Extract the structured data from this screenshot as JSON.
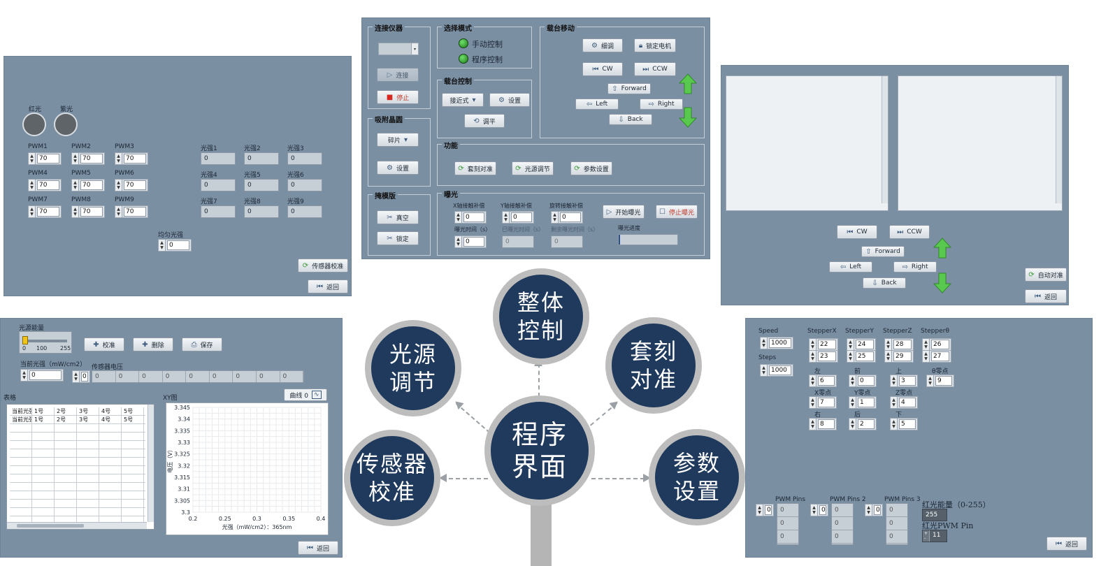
{
  "center": {
    "title": "程序界面"
  },
  "spokes": {
    "overall": "整体控制",
    "light_source": "光源调节",
    "alignment": "套刻对准",
    "sensor": "传感器校准",
    "params": "参数设置"
  },
  "sensor_panel": {
    "lamps": [
      "红光",
      "紫光"
    ],
    "pwm": [
      {
        "label": "PWM1",
        "value": "70"
      },
      {
        "label": "PWM2",
        "value": "70"
      },
      {
        "label": "PWM3",
        "value": "70"
      },
      {
        "label": "PWM4",
        "value": "70"
      },
      {
        "label": "PWM5",
        "value": "70"
      },
      {
        "label": "PWM6",
        "value": "70"
      },
      {
        "label": "PWM7",
        "value": "70"
      },
      {
        "label": "PWM8",
        "value": "70"
      },
      {
        "label": "PWM9",
        "value": "70"
      }
    ],
    "light": [
      {
        "label": "光强1",
        "value": "0"
      },
      {
        "label": "光强2",
        "value": "0"
      },
      {
        "label": "光强3",
        "value": "0"
      },
      {
        "label": "光强4",
        "value": "0"
      },
      {
        "label": "光强5",
        "value": "0"
      },
      {
        "label": "光强6",
        "value": "0"
      },
      {
        "label": "光强7",
        "value": "0"
      },
      {
        "label": "光强8",
        "value": "0"
      },
      {
        "label": "光强9",
        "value": "0"
      }
    ],
    "uniform_label": "均匀光强",
    "uniform_value": "0",
    "calibrate_button": "传感器校准",
    "back_button": "返回"
  },
  "main_panel": {
    "connect_group": "连接仪器",
    "connect_button": "连接",
    "stop_button": "停止",
    "mode_group": "选择模式",
    "mode_manual": "手动控制",
    "mode_program": "程序控制",
    "stage_move_group": "载台移动",
    "fine_button": "细调",
    "lock_motor_button": "锁定电机",
    "cw": "CW",
    "ccw": "CCW",
    "forward": "Forward",
    "left": "Left",
    "right": "Right",
    "back": "Back",
    "stage_ctrl_group": "载台控制",
    "stage_mode": "接近式",
    "settings_button": "设置",
    "level_button": "调平",
    "chuck_group": "吸附晶圆",
    "chuck_mode": "碎片",
    "chuck_settings": "设置",
    "func_group": "功能",
    "func_align": "套刻对准",
    "func_light": "光源调节",
    "func_params": "参数设置",
    "mask_group": "掩模版",
    "vacuum_button": "真空",
    "lock_button": "锁定",
    "exposure_group": "曝光",
    "x_comp_label": "X轴接触补偿",
    "x_comp": "0",
    "y_comp_label": "Y轴接触补偿",
    "y_comp": "0",
    "rot_comp_label": "旋转接触补偿",
    "rot_comp": "0",
    "exp_time_label": "曝光时间（s）",
    "exp_time": "0",
    "elapsed_label": "已曝光时间（s）",
    "elapsed": "0",
    "remaining_label": "剩余曝光时间（s）",
    "remaining": "0",
    "start_button": "开始曝光",
    "stop_exp_button": "停止曝光",
    "progress_label": "曝光进度",
    "progress_value": 0.02
  },
  "align_panel": {
    "cw": "CW",
    "ccw": "CCW",
    "forward": "Forward",
    "left": "Left",
    "right": "Right",
    "back": "Back",
    "auto_align_button": "自动对准",
    "back_button": "返回"
  },
  "light_panel": {
    "energy_label": "光源能量",
    "slider_ticks": [
      "0",
      "100",
      "255"
    ],
    "calibrate_button": "校准",
    "delete_button": "删除",
    "save_button": "保存",
    "current_label": "当前光强（mW/cm2）",
    "current_value": "0",
    "sensor_voltage_label": "传感器电压",
    "sensor_index": "0",
    "sensor_voltages": [
      "0",
      "0",
      "0",
      "0",
      "0",
      "0",
      "0",
      "0",
      "0"
    ],
    "table_label": "表格",
    "xy_label": "XY图",
    "curve_label": "曲线 0",
    "table_rows": [
      [
        "当前光强",
        "1号",
        "2号",
        "3号",
        "4号",
        "5号"
      ],
      [
        "当前光强",
        "1号",
        "2号",
        "3号",
        "4号",
        "5号"
      ]
    ],
    "back_button": "返回"
  },
  "chart_data": {
    "type": "line",
    "x": [],
    "y": [],
    "xlabel": "光强（mW/cm2）：365nm",
    "ylabel": "电压（V）",
    "xlim": [
      0.2,
      0.4
    ],
    "ylim": [
      3.3,
      3.345
    ],
    "xticks": [
      "0.2",
      "0.25",
      "0.3",
      "0.35",
      "0.4"
    ],
    "yticks": [
      "3.345",
      "3.34",
      "3.335",
      "3.33",
      "3.325",
      "3.32",
      "3.315",
      "3.31",
      "3.305",
      "3.3"
    ],
    "grid": true
  },
  "param_panel": {
    "speed_label": "Speed",
    "speed": "1000",
    "steps_label": "Steps",
    "steps": "1000",
    "steppers": [
      {
        "label": "StepperX",
        "v1": "22",
        "v2": "23"
      },
      {
        "label": "StepperY",
        "v1": "24",
        "v2": "25"
      },
      {
        "label": "StepperZ",
        "v1": "28",
        "v2": "29"
      },
      {
        "label": "Stepperθ",
        "v1": "26",
        "v2": "27"
      }
    ],
    "points": [
      {
        "label": "左",
        "value": "6"
      },
      {
        "label": "前",
        "value": "0"
      },
      {
        "label": "上",
        "value": "3"
      },
      {
        "label": "θ零点",
        "value": "9"
      },
      {
        "label": "X零点",
        "value": "7"
      },
      {
        "label": "Y零点",
        "value": "1"
      },
      {
        "label": "Z零点",
        "value": "4"
      },
      {
        "label": "右",
        "value": "8"
      },
      {
        "label": "后",
        "value": "2"
      },
      {
        "label": "下",
        "value": "5"
      }
    ],
    "pwm_pins": [
      {
        "label": "PWM Pins",
        "index": "0"
      },
      {
        "label": "PWM Pins 2",
        "index": "0"
      },
      {
        "label": "PWM Pins 3",
        "index": "0"
      }
    ],
    "slot_values": [
      "0",
      "0",
      "0"
    ],
    "red_energy_label": "红光能量（0-255）",
    "red_energy": "255",
    "red_pin_label": "红光PWM Pin",
    "red_pin": "11",
    "back_button": "返回"
  }
}
